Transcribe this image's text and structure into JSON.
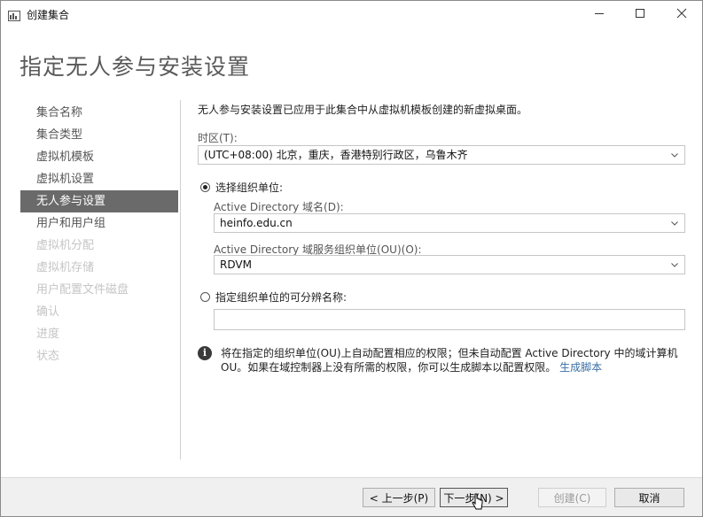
{
  "window": {
    "title": "创建集合",
    "controls": {
      "minimize": "—",
      "maximize": "☐",
      "close": "✕"
    }
  },
  "page": {
    "title": "指定无人参与安装设置"
  },
  "nav": {
    "items": [
      {
        "label": "集合名称",
        "state": "normal"
      },
      {
        "label": "集合类型",
        "state": "normal"
      },
      {
        "label": "虚拟机模板",
        "state": "normal"
      },
      {
        "label": "虚拟机设置",
        "state": "normal"
      },
      {
        "label": "无人参与设置",
        "state": "active"
      },
      {
        "label": "用户和用户组",
        "state": "normal"
      },
      {
        "label": "虚拟机分配",
        "state": "disabled"
      },
      {
        "label": "虚拟机存储",
        "state": "disabled"
      },
      {
        "label": "用户配置文件磁盘",
        "state": "disabled"
      },
      {
        "label": "确认",
        "state": "disabled"
      },
      {
        "label": "进度",
        "state": "disabled"
      },
      {
        "label": "状态",
        "state": "disabled"
      }
    ]
  },
  "content": {
    "description": "无人参与安装设置已应用于此集合中从虚拟机模板创建的新虚拟桌面。",
    "timezone": {
      "label": "时区(T):",
      "value": "(UTC+08:00) 北京，重庆，香港特别行政区，乌鲁木齐"
    },
    "option_select_ou": {
      "label": "选择组织单位:",
      "checked": true,
      "domain_label": "Active Directory 域名(D):",
      "domain_value": "heinfo.edu.cn",
      "ou_label": "Active Directory 域服务组织单位(OU)(O):",
      "ou_value": "RDVM"
    },
    "option_specify_dn": {
      "label": "指定组织单位的可分辨名称:",
      "checked": false,
      "value": ""
    },
    "info": {
      "text": "将在指定的组织单位(OU)上自动配置相应的权限；但未自动配置 Active Directory 中的域计算机 OU。如果在域控制器上没有所需的权限，你可以生成脚本以配置权限。",
      "link": "生成脚本"
    }
  },
  "footer": {
    "prev": "< 上一步(P)",
    "next": "下一步(N) >",
    "create": "创建(C)",
    "cancel": "取消"
  }
}
